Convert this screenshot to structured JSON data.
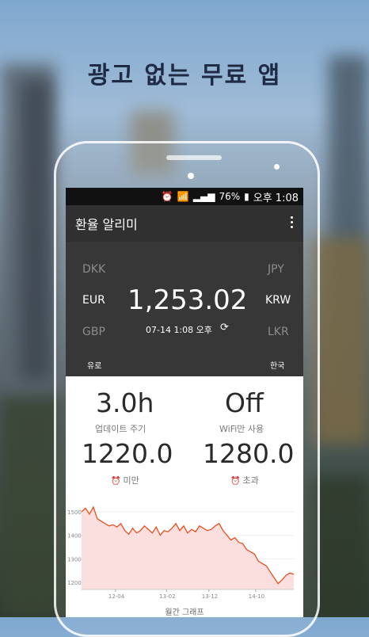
{
  "tagline": "광고 없는 무료 앱",
  "status_bar": {
    "battery": "76%",
    "time": "오후 1:08"
  },
  "app_bar": {
    "title": "환율 알리미"
  },
  "converter": {
    "left_currencies": [
      "DKK",
      "EUR",
      "GBP"
    ],
    "right_currencies": [
      "JPY",
      "KRW",
      "LKR"
    ],
    "rate": "1,253.02",
    "timestamp": "07-14 1:08 오후",
    "from_name": "유로",
    "to_name": "한국"
  },
  "settings": {
    "update_interval_value": "3.0h",
    "update_interval_label": "업데이트 주기",
    "wifi_only_value": "Off",
    "wifi_only_label": "WiFi만 사용",
    "lower_alert_value": "1220.0",
    "lower_alert_label": "미만",
    "upper_alert_value": "1280.0",
    "upper_alert_label": "초과"
  },
  "chart_data": {
    "type": "area",
    "title": "월간 그래프",
    "x_tick_labels": [
      "12-04",
      "13-02",
      "13-12",
      "14-10"
    ],
    "y_tick_labels": [
      "1500",
      "1400",
      "1300",
      "1200"
    ],
    "ylim": [
      1170,
      1530
    ],
    "values": [
      1500,
      1515,
      1490,
      1520,
      1470,
      1460,
      1450,
      1440,
      1445,
      1435,
      1450,
      1420,
      1405,
      1430,
      1410,
      1420,
      1440,
      1425,
      1410,
      1435,
      1400,
      1420,
      1415,
      1430,
      1450,
      1420,
      1440,
      1410,
      1425,
      1415,
      1440,
      1430,
      1420,
      1425,
      1440,
      1450,
      1420,
      1400,
      1380,
      1390,
      1370,
      1365,
      1340,
      1330,
      1320,
      1290,
      1280,
      1270,
      1245,
      1220,
      1195,
      1210,
      1230,
      1240,
      1235
    ],
    "line_color": "#e8501e",
    "fill_color": "#fbdede"
  }
}
